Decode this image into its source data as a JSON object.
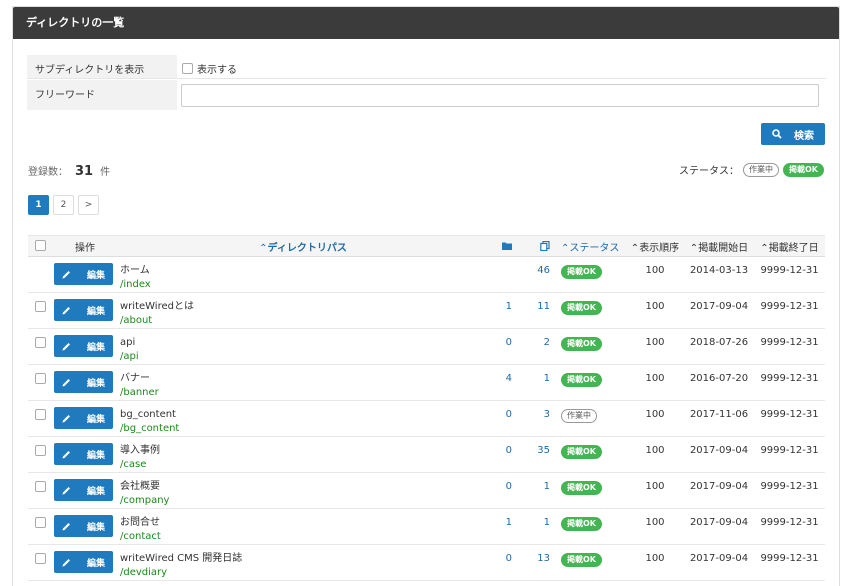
{
  "header": {
    "title": "ディレクトリの一覧"
  },
  "filters": {
    "show_sub_label": "サブディレクトリを表示",
    "show_sub_checkbox_label": "表示する",
    "freeword_label": "フリーワード",
    "freeword_value": "",
    "search_button_label": "検索"
  },
  "summary": {
    "count_prefix": "登録数：",
    "count": "31",
    "count_suffix": "件"
  },
  "status_legend": {
    "label": "ステータス：",
    "wip": "作業中",
    "ok": "掲載OK"
  },
  "pagination": {
    "pages": [
      "1",
      "2"
    ],
    "next": ">",
    "current": "1"
  },
  "table": {
    "headers": {
      "operation": "操作",
      "path": "ディレクトリパス",
      "status": "ステータス",
      "order": "表示順序",
      "start_date": "掲載開始日",
      "end_date": "掲載終了日"
    },
    "edit_label": "編集",
    "rows": [
      {
        "name": "ホーム",
        "path": "/index",
        "dirs": "",
        "pages": "46",
        "status": "掲載OK",
        "status_type": "ok",
        "order": "100",
        "start": "2014-03-13",
        "end": "9999-12-31",
        "checkbox": false
      },
      {
        "name": "writeWiredとは",
        "path": "/about",
        "dirs": "1",
        "pages": "11",
        "status": "掲載OK",
        "status_type": "ok",
        "order": "100",
        "start": "2017-09-04",
        "end": "9999-12-31",
        "checkbox": true
      },
      {
        "name": "api",
        "path": "/api",
        "dirs": "0",
        "pages": "2",
        "status": "掲載OK",
        "status_type": "ok",
        "order": "100",
        "start": "2018-07-26",
        "end": "9999-12-31",
        "checkbox": true
      },
      {
        "name": "バナー",
        "path": "/banner",
        "dirs": "4",
        "pages": "1",
        "status": "掲載OK",
        "status_type": "ok",
        "order": "100",
        "start": "2016-07-20",
        "end": "9999-12-31",
        "checkbox": true
      },
      {
        "name": "bg_content",
        "path": "/bg_content",
        "dirs": "0",
        "pages": "3",
        "status": "作業中",
        "status_type": "wip",
        "order": "100",
        "start": "2017-11-06",
        "end": "9999-12-31",
        "checkbox": true
      },
      {
        "name": "導入事例",
        "path": "/case",
        "dirs": "0",
        "pages": "35",
        "status": "掲載OK",
        "status_type": "ok",
        "order": "100",
        "start": "2017-09-04",
        "end": "9999-12-31",
        "checkbox": true
      },
      {
        "name": "会社概要",
        "path": "/company",
        "dirs": "0",
        "pages": "1",
        "status": "掲載OK",
        "status_type": "ok",
        "order": "100",
        "start": "2017-09-04",
        "end": "9999-12-31",
        "checkbox": true
      },
      {
        "name": "お問合せ",
        "path": "/contact",
        "dirs": "1",
        "pages": "1",
        "status": "掲載OK",
        "status_type": "ok",
        "order": "100",
        "start": "2017-09-04",
        "end": "9999-12-31",
        "checkbox": true
      },
      {
        "name": "writeWired CMS 開発日誌",
        "path": "/devdiary",
        "dirs": "0",
        "pages": "13",
        "status": "掲載OK",
        "status_type": "ok",
        "order": "100",
        "start": "2017-09-04",
        "end": "9999-12-31",
        "checkbox": true
      }
    ]
  },
  "colors": {
    "primary": "#1f7bbd",
    "ok": "#43b553",
    "header_bg": "#3b3b3b",
    "path_green": "#1a8a1a"
  },
  "icons": {
    "search": "search-icon",
    "edit": "pencil-icon",
    "folder": "folder-icon",
    "pages": "pages-icon",
    "sort": "sort-asc-icon"
  }
}
